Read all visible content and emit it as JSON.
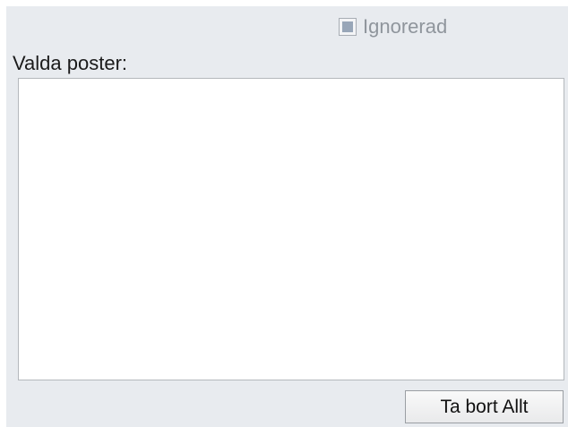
{
  "ignore_checkbox": {
    "label": "Ignorerad",
    "checked": true,
    "disabled": true
  },
  "selected_items": {
    "label": "Valda poster:",
    "items": []
  },
  "actions": {
    "remove_all_label": "Ta bort Allt"
  },
  "colors": {
    "panel_background": "#e8ebef",
    "list_background": "#ffffff",
    "disabled_text": "#8f959c",
    "checkbox_fill": "#98a6b8"
  }
}
